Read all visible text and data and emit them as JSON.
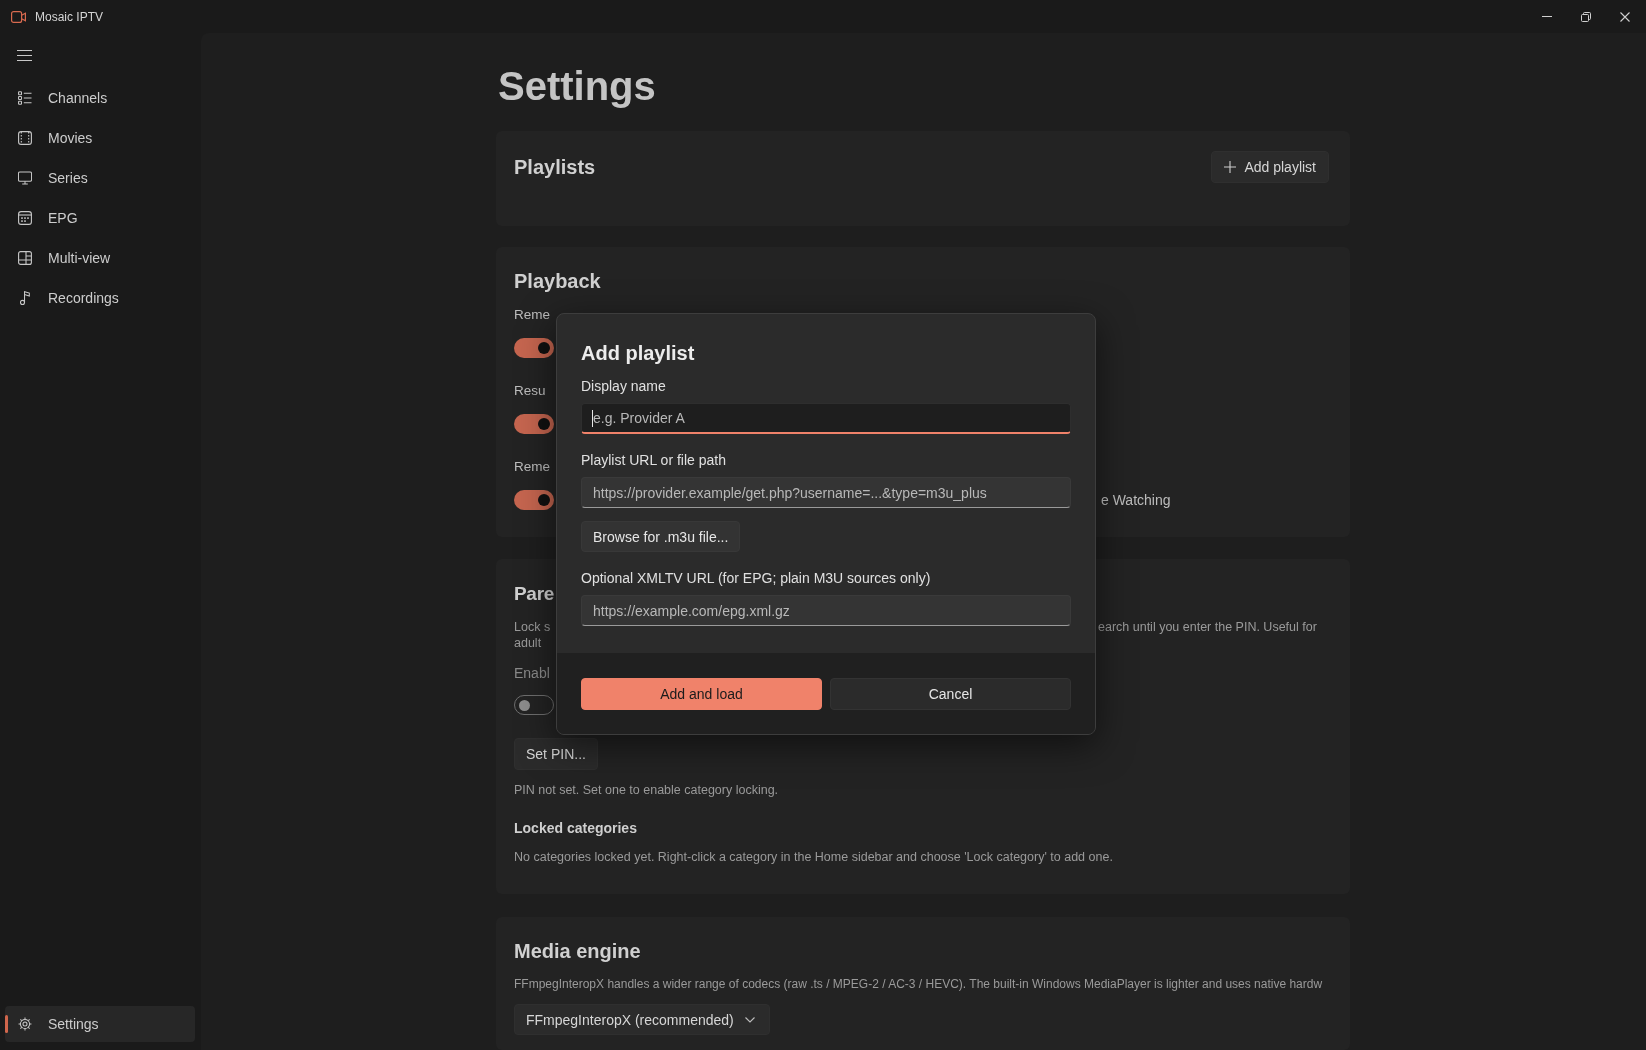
{
  "window": {
    "title": "Mosaic IPTV"
  },
  "sidebar": {
    "items": [
      {
        "label": "Channels",
        "selected": false
      },
      {
        "label": "Movies",
        "selected": false
      },
      {
        "label": "Series",
        "selected": false
      },
      {
        "label": "EPG",
        "selected": false
      },
      {
        "label": "Multi-view",
        "selected": false
      },
      {
        "label": "Recordings",
        "selected": false
      }
    ],
    "footer_items": [
      {
        "label": "Settings",
        "selected": true
      }
    ]
  },
  "page": {
    "title": "Settings"
  },
  "playlists": {
    "title": "Playlists",
    "add_button": "Add playlist"
  },
  "playback": {
    "title": "Playback",
    "settings": [
      {
        "label": "Reme",
        "on": true
      },
      {
        "label": "Resu",
        "on": true
      },
      {
        "label": "Reme",
        "on": true,
        "side_text": "e Watching"
      }
    ]
  },
  "parental": {
    "title": "Pare",
    "description_lines": [
      {
        "left": "Lock s",
        "right": "earch until you enter the PIN. Useful for"
      },
      {
        "left": "adult"
      }
    ],
    "enable": {
      "label": "Enabl",
      "on": false
    },
    "pin_button": "Set PIN...",
    "pin_status": "PIN not set. Set one to enable category locking.",
    "locked_title": "Locked categories",
    "locked_empty": "No categories locked yet. Right-click a category in the Home sidebar and choose 'Lock category' to add one."
  },
  "media_engine": {
    "title": "Media engine",
    "description": "FFmpegInteropX handles a wider range of codecs (raw .ts / MPEG-2 / AC-3 / HEVC). The built-in Windows MediaPlayer is lighter and uses native hardw",
    "engine_select": {
      "value": "FFmpegInteropX (recommended)"
    }
  },
  "dialog": {
    "title": "Add playlist",
    "items": [
      {
        "kind": "field",
        "label": "Display name",
        "placeholder": "e.g. Provider A",
        "focused": true
      },
      {
        "kind": "field",
        "label": "Playlist URL or file path",
        "placeholder": "https://provider.example/get.php?username=...&type=m3u_plus",
        "focused": false
      },
      {
        "kind": "button",
        "label": "Browse for .m3u file..."
      },
      {
        "kind": "field",
        "label": "Optional XMLTV URL (for EPG; plain M3U sources only)",
        "placeholder": "https://example.com/epg.xml.gz",
        "focused": false
      }
    ],
    "primary_button": "Add and load",
    "secondary_button": "Cancel"
  }
}
